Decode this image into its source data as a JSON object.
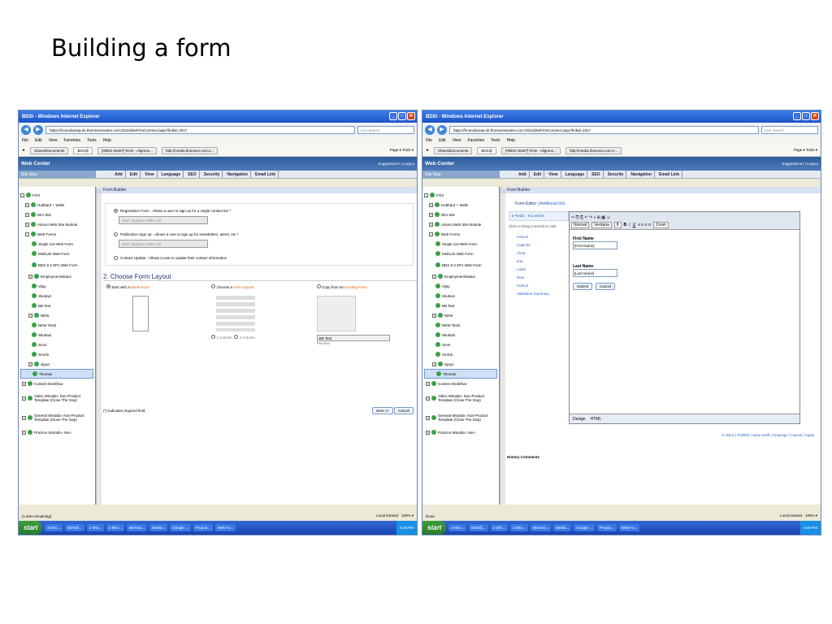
{
  "slide_title": "Building a form",
  "browser": {
    "window_title": "BDSi - Windows Internet Explorer",
    "url": "https://hi-productqa.int.thomsonreuters.com:2011/site/FirmConnect.aspx?linkid=1917",
    "search_placeholder": "Live Search",
    "menu": [
      "File",
      "Edit",
      "View",
      "Favorites",
      "Tools",
      "Help"
    ],
    "tabs": [
      "SharedDocuments",
      "BDS@",
      "[#BDS-16457] RAD - Alignme...",
      "http://media.thomson.com.e..."
    ],
    "tools": "Page ▾  Tools ▾"
  },
  "webcenter": {
    "title": "Web Center",
    "links": "Suggestions? | Logout",
    "site_map": "Site Map",
    "toolbar": [
      "Add",
      "Edit",
      "View",
      "Language",
      "SEO",
      "Security",
      "Navigation",
      "Email Link"
    ]
  },
  "tree": [
    "FOX",
    "Hubbard + Wells",
    "Wm Site",
    "Alumni Web Site Module",
    "Web Forms",
    "Single List Web Form",
    "MultiList Web Form",
    "BDS 8.3 SP1 Web Form",
    "EmploymentStatus",
    "Vijay",
    "Skuttai1",
    "BB Test",
    "NEW",
    "NEW Test2",
    "Skuttai2",
    "Smm",
    "Smm5",
    "vijay1",
    "Thomas",
    "Content Workflow",
    "Video Winaldo- Non-Product Template (Close The Gap)",
    "General Winaldo- Non-Product Template (Close The Gap)",
    "Practice Winaldo- Non-"
  ],
  "screen1": {
    "panel": "Form Builder",
    "opt1": "Registration Form - Allows a user to sign up for a single contact list *",
    "opt2": "Publication Sign up - Allows a user to sign up for newsletters, alerts, etc *",
    "opt3": "Contact Update - Allows a user to update their contact information",
    "filter": "Start Typing to Filter List",
    "section": "2. Choose Form Layout",
    "l1a": "Start with a ",
    "l1b": "Blank Form",
    "l2a": "Choose a ",
    "l2b": "Form Layout",
    "l3a": "Copy from an ",
    "l3b": "Existing Form",
    "col1": "1 Column",
    "col2": "2 Column",
    "copy_sel": "BB Test",
    "preview": "Preview",
    "required": "(*) Indicates required field.",
    "next": "Next >>",
    "cancel": "Cancel",
    "status_left": "(1 item remaining)"
  },
  "screen2": {
    "panel": "Form Builder",
    "fe1": "Form Editor",
    "fe2": "Additional Info",
    "tab_fields": "▸ Fields",
    "tab_controls": "▾ Controls",
    "hint": "Click or Drag Controls to Add",
    "controls": [
      "Cancel",
      "Captcha",
      "Clear",
      "Exit",
      "Label",
      "New",
      "Submit",
      "Validation Summary"
    ],
    "style": "Normal",
    "font": "Verdana",
    "size": "8",
    "zoom": "Zoom",
    "first_label": "First Name",
    "first_val": "[First Name]",
    "last_label": "Last Name",
    "last_val": "[Last Name]",
    "submit": "Submit",
    "cancel": "Cancel",
    "design": "Design",
    "html": "HTML",
    "actions": "<< Back  |  Publish  |  Save Draft  |  Unassign  |  Cancel  |  Apply",
    "history": "History Comments",
    "status_left": "Done"
  },
  "status": {
    "zone": "Local intranet",
    "zoom": "100% ▾"
  },
  "taskbar": {
    "start": "start",
    "tasks": [
      "2 Micr...",
      "BDS@...",
      "2 Win...",
      "2 Micr...",
      "Microso...",
      "Media...",
      "Google ...",
      "Propos...",
      "Web Fo..."
    ],
    "time1": "6:33 PM",
    "time2": "6:45 PM"
  }
}
